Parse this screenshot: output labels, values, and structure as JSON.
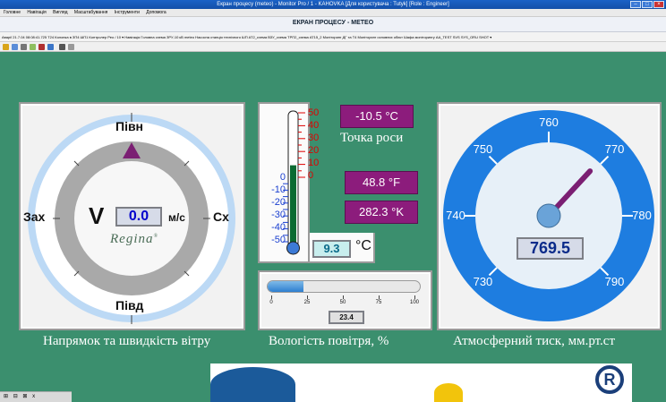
{
  "window": {
    "title": "Екран процесу (meteo) - Monitor Pro / 1 - KAHOVKA [Для користувача : Tutyk] [Role : Engineer]"
  },
  "menu": {
    "items": [
      "Головне",
      "Навігація",
      "Вигляд",
      "Масштабування",
      "Інструменти",
      "Допомога"
    ]
  },
  "screen_title": "ЕКРАН ПРОЦЕСУ - МЕТЕО",
  "nav_strip": "Аварії 21.7.04 08:08:41.725 T24 Колонка в ЗП4   ШП1 Контролер Рео / 10 ▾   Навігація  Головна схема  ЗРУ-10 кВ  meteo  Насосна станція технічного  ШП  АТ2_схема  ВЗУ_схема  ТРП2_схема  АТ15_2  Моніторинг ДГ та Т4  Моніторинг основних обєкт  Шафа моніторингу  АА_TEST  SVS  SYS_ORU  SHOT ▾",
  "wind": {
    "north": "Півн",
    "south": "Півд",
    "west": "Зах",
    "east": "Сх",
    "v_label": "V",
    "speed": "0.0",
    "unit": "м/с",
    "brand": "Regina",
    "brand_mark": "®",
    "caption": "Напрямок та швидкість вітру",
    "direction_deg": 0
  },
  "temperature": {
    "scale_pos": [
      "50",
      "40",
      "30",
      "20",
      "10",
      "0"
    ],
    "scale_neg": [
      "0",
      "-10",
      "-20",
      "-30",
      "-40",
      "-50"
    ],
    "value": "9.3",
    "unit": "°C",
    "dew_point": "-10.5 °C",
    "dew_label": "Точка роси",
    "fahrenheit": "48.8 °F",
    "kelvin": "282.3 °K",
    "value_c": 9.3
  },
  "humidity": {
    "ticks": [
      "0",
      "25",
      "50",
      "75",
      "100"
    ],
    "value": "23.4",
    "percent": 23.4,
    "caption": "Вологість повітря, %"
  },
  "pressure": {
    "ticks": [
      "730",
      "740",
      "750",
      "760",
      "770",
      "780",
      "790"
    ],
    "value": "769.5",
    "value_num": 769.5,
    "caption": "Атмосферний тиск, мм.рт.ст"
  },
  "taskbar": {
    "items": [
      "⊞",
      "⊟",
      "⊠",
      "x"
    ]
  },
  "colors": {
    "background": "#3b8f6e",
    "accent_purple": "#8c1c7c",
    "gauge_blue": "#1e7de0",
    "value_blue": "#0000cc"
  }
}
